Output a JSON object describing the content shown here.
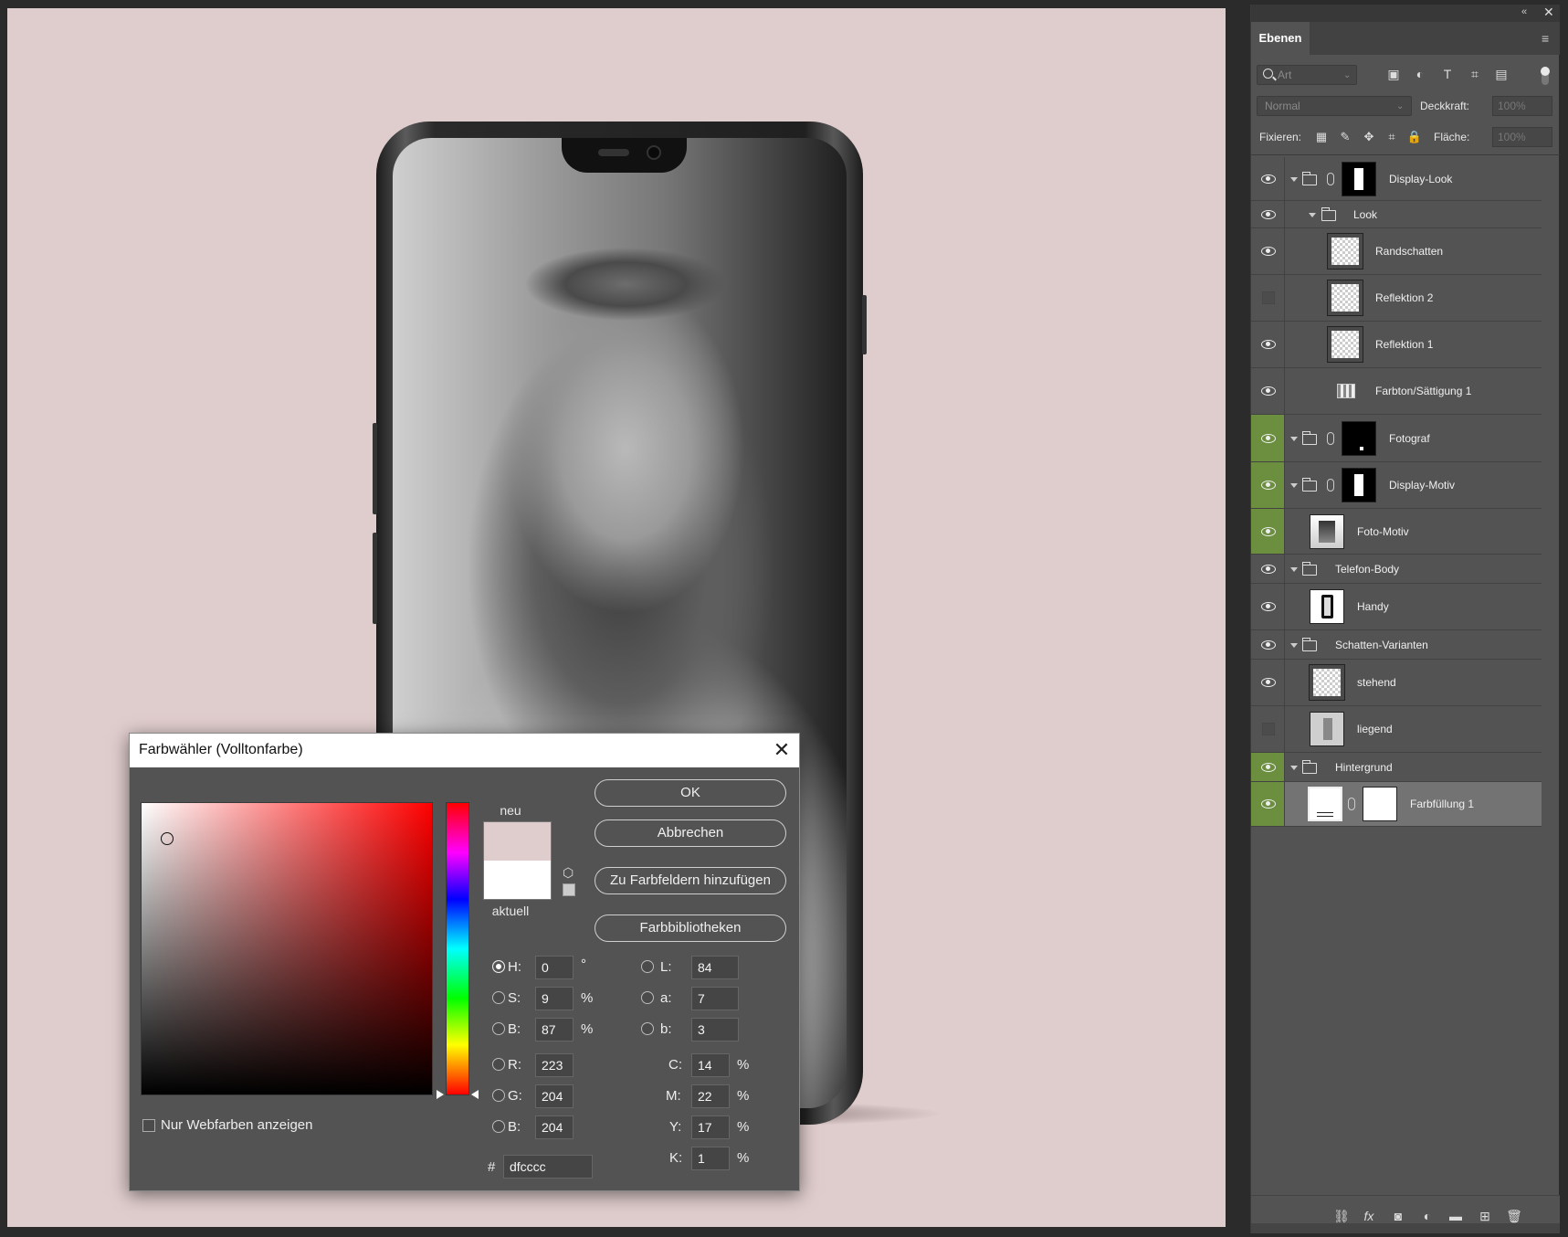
{
  "document": {
    "background_color": "#dfcccc"
  },
  "color_picker": {
    "title": "Farbwähler (Volltonfarbe)",
    "new_label": "neu",
    "current_label": "aktuell",
    "new_color": "#dfcccc",
    "current_color": "#ffffff",
    "buttons": {
      "ok": "OK",
      "cancel": "Abbrechen",
      "add_to_swatches": "Zu Farbfeldern hinzufügen",
      "color_libraries": "Farbbibliotheken"
    },
    "hsb": {
      "h_label": "H:",
      "h_value": "0",
      "h_unit": "°",
      "s_label": "S:",
      "s_value": "9",
      "s_unit": "%",
      "b_label": "B:",
      "b_value": "87",
      "b_unit": "%"
    },
    "rgb": {
      "r_label": "R:",
      "r_value": "223",
      "g_label": "G:",
      "g_value": "204",
      "b_label": "B:",
      "b_value": "204"
    },
    "lab": {
      "l_label": "L:",
      "l_value": "84",
      "a_label": "a:",
      "a_value": "7",
      "b_label": "b:",
      "b_value": "3"
    },
    "cmyk": {
      "c_label": "C:",
      "c_value": "14",
      "m_label": "M:",
      "m_value": "22",
      "y_label": "Y:",
      "y_value": "17",
      "k_label": "K:",
      "k_value": "1",
      "unit": "%"
    },
    "hex_label": "#",
    "hex_value": "dfcccc",
    "websafe_label": "Nur Webfarben anzeigen",
    "selected_mode": "H"
  },
  "layers_panel": {
    "tab": "Ebenen",
    "filter_placeholder": "Art",
    "blend_mode": "Normal",
    "opacity_label": "Deckkraft:",
    "opacity_value": "100%",
    "lock_label": "Fixieren:",
    "fill_label": "Fläche:",
    "fill_value": "100%",
    "layers": [
      {
        "name": "Display-Look",
        "type": "group",
        "visible": true
      },
      {
        "name": "Look",
        "type": "group",
        "visible": true
      },
      {
        "name": "Randschatten",
        "type": "layer",
        "visible": true
      },
      {
        "name": "Reflektion 2",
        "type": "layer",
        "visible": false
      },
      {
        "name": "Reflektion 1",
        "type": "layer",
        "visible": true
      },
      {
        "name": "Farbton/Sättigung 1",
        "type": "adjustment",
        "visible": true
      },
      {
        "name": "Fotograf",
        "type": "group",
        "visible": true
      },
      {
        "name": "Display-Motiv",
        "type": "group",
        "visible": true
      },
      {
        "name": "Foto-Motiv",
        "type": "layer",
        "visible": true
      },
      {
        "name": "Telefon-Body",
        "type": "group",
        "visible": true
      },
      {
        "name": "Handy",
        "type": "layer",
        "visible": true
      },
      {
        "name": "Schatten-Varianten",
        "type": "group",
        "visible": true
      },
      {
        "name": "stehend",
        "type": "layer",
        "visible": true
      },
      {
        "name": "liegend",
        "type": "layer",
        "visible": false
      },
      {
        "name": "Hintergrund",
        "type": "group",
        "visible": true
      },
      {
        "name": "Farbfüllung 1",
        "type": "fill",
        "visible": true,
        "selected": true
      }
    ]
  }
}
